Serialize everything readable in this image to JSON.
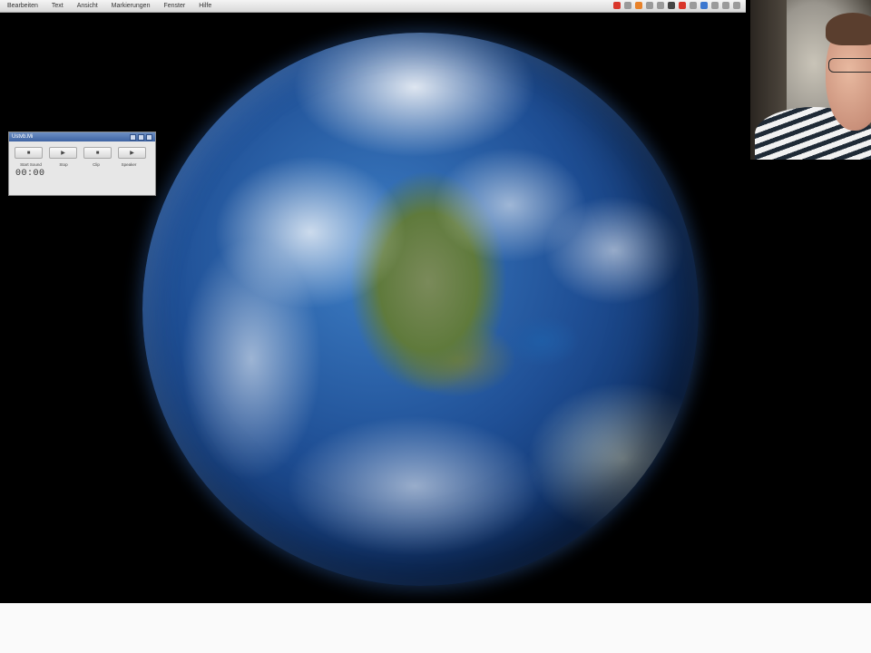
{
  "menubar": {
    "items": [
      "Bearbeiten",
      "Text",
      "Ansicht",
      "Markierungen",
      "Fenster",
      "Hilfe"
    ],
    "status_icons": [
      "red-app-icon",
      "gray-icon",
      "orange-icon",
      "gray-icon",
      "gray-icon",
      "dark-icon",
      "red-icon",
      "gray-icon",
      "blue-icon",
      "gray-icon",
      "gray-icon",
      "gray-icon"
    ],
    "colors": {
      "red": "#d9362b",
      "orange": "#e8822a",
      "gray": "#9a9a9a",
      "blue": "#3c78d0",
      "dark": "#444444"
    }
  },
  "app_window": {
    "title": "Ustvb.Mi",
    "buttons": [
      "■",
      "▶",
      "■",
      "▶"
    ],
    "button_icons": [
      "stop-icon",
      "play-icon",
      "stop-icon",
      "play-icon"
    ],
    "labels": [
      "Start Sound",
      "Stop",
      "Clip",
      "Speaker"
    ],
    "time": "00:00"
  },
  "screen": {
    "background": "#000000",
    "image": "earth-globe"
  }
}
